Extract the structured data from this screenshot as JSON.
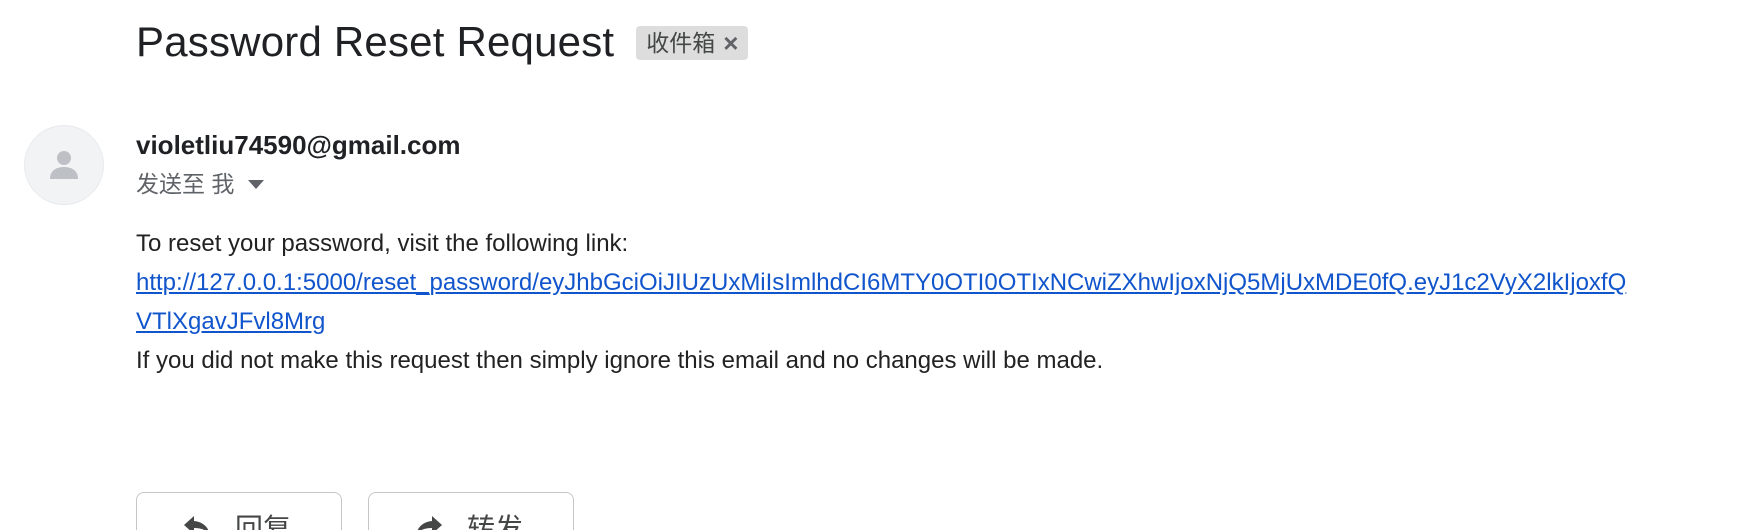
{
  "email": {
    "subject": "Password Reset Request",
    "label_chip": {
      "text": "收件箱",
      "close_glyph": "×"
    },
    "sender": "violetliu74590@gmail.com",
    "recipient": {
      "prefix": "发送至 我"
    },
    "body": {
      "intro": "To reset your password, visit the following link:",
      "link_line1": "http://127.0.0.1:5000/reset_password/eyJhbGciOiJIUzUxMiIsImlhdCI6MTY0OTI0OTIxNCwiZXhwIjoxNjQ5MjUxMDE0fQ.eyJ1c2VyX2lkIjoxfQ",
      "link_line2": "VTlXgavJFvl8Mrg",
      "outro": "If you did not make this request then simply ignore this email and no changes will be made."
    },
    "actions": {
      "reply_label": "回复",
      "forward_label": "转发"
    }
  },
  "icons": {
    "avatar": "person-icon",
    "caret": "caret-down-icon",
    "reply": "reply-icon",
    "forward": "forward-icon"
  },
  "colors": {
    "link": "#1155cc",
    "chip_bg": "#dddddd",
    "text": "#202124",
    "muted": "#5f6368"
  }
}
